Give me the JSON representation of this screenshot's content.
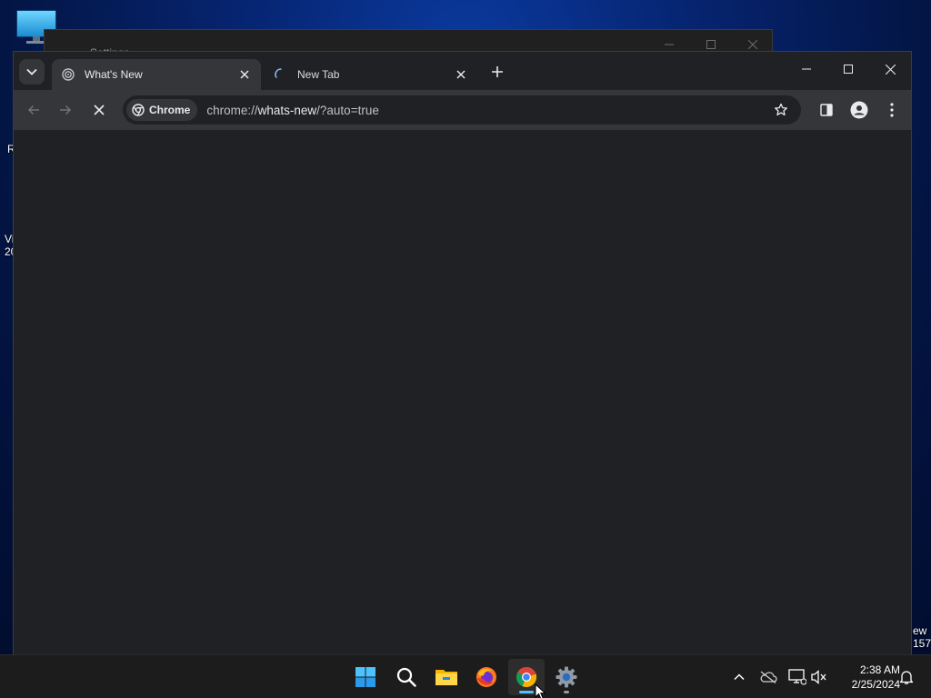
{
  "desktop": {
    "left_fragments": [
      "R",
      "Vi",
      "20"
    ],
    "right_fragments": [
      "ew",
      "157"
    ]
  },
  "background_window": {
    "title": "Settings"
  },
  "chrome": {
    "tabs": [
      {
        "title": "What's New",
        "active": true
      },
      {
        "title": "New Tab",
        "active": false
      }
    ],
    "address_bar": {
      "chip_label": "Chrome",
      "url_scheme": "chrome://",
      "url_host": "whats-new",
      "url_rest": "/?auto=true"
    }
  },
  "taskbar": {
    "apps": [
      {
        "name": "Start",
        "icon": "windows-logo-icon"
      },
      {
        "name": "Search",
        "icon": "search-icon"
      },
      {
        "name": "File Explorer",
        "icon": "folder-icon"
      },
      {
        "name": "Firefox",
        "icon": "firefox-icon"
      },
      {
        "name": "Google Chrome",
        "icon": "chrome-icon",
        "active": true
      },
      {
        "name": "Settings",
        "icon": "gear-icon"
      }
    ],
    "clock": {
      "time": "2:38 AM",
      "date": "2/25/2024"
    }
  },
  "colors": {
    "accent_blue": "#4cc2ff",
    "chrome_frame": "#202124",
    "chrome_toolbar": "#35363a"
  }
}
